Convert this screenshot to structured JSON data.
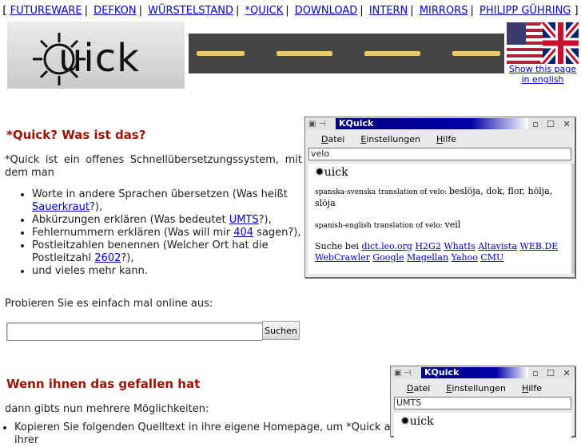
{
  "topnav": {
    "open": "[",
    "close": "]",
    "links": [
      "FUTUREWARE",
      "DEFKON",
      "WÜRSTELSTAND",
      "*QUICK",
      "DOWNLOAD",
      "INTERN",
      "MIRRORS",
      "PHILIPP GÜHRING"
    ]
  },
  "logo": {
    "text": "uick"
  },
  "english_link": "Show this page in english",
  "what": {
    "heading": "*Quick? Was ist das?",
    "intro": "*Quick ist ein offenes Schnellübersetzungssystem, mit dem man",
    "items": [
      {
        "pre": "Worte in andere Sprachen übersetzen (Was heißt ",
        "link": "Sauerkraut",
        "post": "?),"
      },
      {
        "pre": "Abkürzungen erklären (Was bedeutet ",
        "link": "UMTS",
        "post": "?),"
      },
      {
        "pre": "Fehlernummern erklären (Was will mir ",
        "link": "404",
        "post": " sagen?),"
      },
      {
        "pre": "Postleitzahlen benennen (Welcher Ort hat die Postleitzahl ",
        "link": "2602",
        "post": "?),"
      },
      {
        "pre": "und vieles mehr kann.",
        "link": "",
        "post": ""
      }
    ]
  },
  "try_text": "Probieren Sie es einfach mal online aus:",
  "search": {
    "value": "",
    "button": "Suchen"
  },
  "liked": {
    "heading": "Wenn ihnen das gefallen hat",
    "options": "dann gibts nun mehrere Möglichkeiten:",
    "copy": "Kopieren Sie folgenden Quelltext in ihre eigene Homepage, um *Quick auf ihrer"
  },
  "kwin1": {
    "title": "KQuick",
    "menu": [
      "Datei",
      "Einstellungen",
      "Hilfe"
    ],
    "input": "velo",
    "logo": "uick",
    "line1_label": "spanska-svenska translation of velo:",
    "line1_value": "beslöja, dok, flor, hölja, slöja",
    "line2_label": "spanish-english translation of velo:",
    "line2_value": "veil",
    "search_label": "Suche bei",
    "search_links": [
      "dict.leo.org",
      "H2G2",
      "WhatIs",
      "Altavista",
      "WEB.DE",
      "WebCrawler",
      "Google",
      "Magellan",
      "Yahoo",
      "CMU"
    ]
  },
  "kwin2": {
    "title": "KQuick",
    "menu": [
      "Datei",
      "Einstellungen",
      "Hilfe"
    ],
    "input": "UMTS",
    "logo": "uick"
  }
}
